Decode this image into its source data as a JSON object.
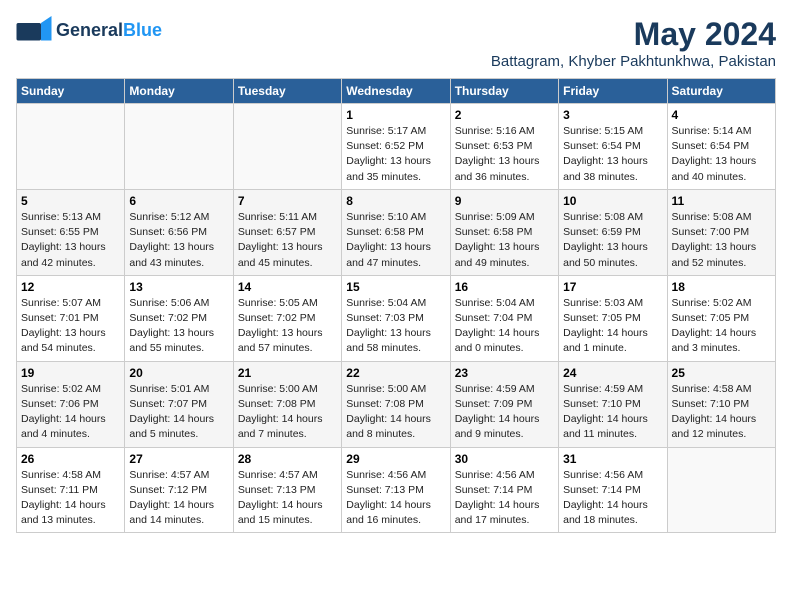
{
  "logo": {
    "general": "General",
    "blue": "Blue"
  },
  "title": {
    "month": "May 2024",
    "location": "Battagram, Khyber Pakhtunkhwa, Pakistan"
  },
  "headers": [
    "Sunday",
    "Monday",
    "Tuesday",
    "Wednesday",
    "Thursday",
    "Friday",
    "Saturday"
  ],
  "weeks": [
    [
      {
        "day": "",
        "info": ""
      },
      {
        "day": "",
        "info": ""
      },
      {
        "day": "",
        "info": ""
      },
      {
        "day": "1",
        "info": "Sunrise: 5:17 AM\nSunset: 6:52 PM\nDaylight: 13 hours\nand 35 minutes."
      },
      {
        "day": "2",
        "info": "Sunrise: 5:16 AM\nSunset: 6:53 PM\nDaylight: 13 hours\nand 36 minutes."
      },
      {
        "day": "3",
        "info": "Sunrise: 5:15 AM\nSunset: 6:54 PM\nDaylight: 13 hours\nand 38 minutes."
      },
      {
        "day": "4",
        "info": "Sunrise: 5:14 AM\nSunset: 6:54 PM\nDaylight: 13 hours\nand 40 minutes."
      }
    ],
    [
      {
        "day": "5",
        "info": "Sunrise: 5:13 AM\nSunset: 6:55 PM\nDaylight: 13 hours\nand 42 minutes."
      },
      {
        "day": "6",
        "info": "Sunrise: 5:12 AM\nSunset: 6:56 PM\nDaylight: 13 hours\nand 43 minutes."
      },
      {
        "day": "7",
        "info": "Sunrise: 5:11 AM\nSunset: 6:57 PM\nDaylight: 13 hours\nand 45 minutes."
      },
      {
        "day": "8",
        "info": "Sunrise: 5:10 AM\nSunset: 6:58 PM\nDaylight: 13 hours\nand 47 minutes."
      },
      {
        "day": "9",
        "info": "Sunrise: 5:09 AM\nSunset: 6:58 PM\nDaylight: 13 hours\nand 49 minutes."
      },
      {
        "day": "10",
        "info": "Sunrise: 5:08 AM\nSunset: 6:59 PM\nDaylight: 13 hours\nand 50 minutes."
      },
      {
        "day": "11",
        "info": "Sunrise: 5:08 AM\nSunset: 7:00 PM\nDaylight: 13 hours\nand 52 minutes."
      }
    ],
    [
      {
        "day": "12",
        "info": "Sunrise: 5:07 AM\nSunset: 7:01 PM\nDaylight: 13 hours\nand 54 minutes."
      },
      {
        "day": "13",
        "info": "Sunrise: 5:06 AM\nSunset: 7:02 PM\nDaylight: 13 hours\nand 55 minutes."
      },
      {
        "day": "14",
        "info": "Sunrise: 5:05 AM\nSunset: 7:02 PM\nDaylight: 13 hours\nand 57 minutes."
      },
      {
        "day": "15",
        "info": "Sunrise: 5:04 AM\nSunset: 7:03 PM\nDaylight: 13 hours\nand 58 minutes."
      },
      {
        "day": "16",
        "info": "Sunrise: 5:04 AM\nSunset: 7:04 PM\nDaylight: 14 hours\nand 0 minutes."
      },
      {
        "day": "17",
        "info": "Sunrise: 5:03 AM\nSunset: 7:05 PM\nDaylight: 14 hours\nand 1 minute."
      },
      {
        "day": "18",
        "info": "Sunrise: 5:02 AM\nSunset: 7:05 PM\nDaylight: 14 hours\nand 3 minutes."
      }
    ],
    [
      {
        "day": "19",
        "info": "Sunrise: 5:02 AM\nSunset: 7:06 PM\nDaylight: 14 hours\nand 4 minutes."
      },
      {
        "day": "20",
        "info": "Sunrise: 5:01 AM\nSunset: 7:07 PM\nDaylight: 14 hours\nand 5 minutes."
      },
      {
        "day": "21",
        "info": "Sunrise: 5:00 AM\nSunset: 7:08 PM\nDaylight: 14 hours\nand 7 minutes."
      },
      {
        "day": "22",
        "info": "Sunrise: 5:00 AM\nSunset: 7:08 PM\nDaylight: 14 hours\nand 8 minutes."
      },
      {
        "day": "23",
        "info": "Sunrise: 4:59 AM\nSunset: 7:09 PM\nDaylight: 14 hours\nand 9 minutes."
      },
      {
        "day": "24",
        "info": "Sunrise: 4:59 AM\nSunset: 7:10 PM\nDaylight: 14 hours\nand 11 minutes."
      },
      {
        "day": "25",
        "info": "Sunrise: 4:58 AM\nSunset: 7:10 PM\nDaylight: 14 hours\nand 12 minutes."
      }
    ],
    [
      {
        "day": "26",
        "info": "Sunrise: 4:58 AM\nSunset: 7:11 PM\nDaylight: 14 hours\nand 13 minutes."
      },
      {
        "day": "27",
        "info": "Sunrise: 4:57 AM\nSunset: 7:12 PM\nDaylight: 14 hours\nand 14 minutes."
      },
      {
        "day": "28",
        "info": "Sunrise: 4:57 AM\nSunset: 7:13 PM\nDaylight: 14 hours\nand 15 minutes."
      },
      {
        "day": "29",
        "info": "Sunrise: 4:56 AM\nSunset: 7:13 PM\nDaylight: 14 hours\nand 16 minutes."
      },
      {
        "day": "30",
        "info": "Sunrise: 4:56 AM\nSunset: 7:14 PM\nDaylight: 14 hours\nand 17 minutes."
      },
      {
        "day": "31",
        "info": "Sunrise: 4:56 AM\nSunset: 7:14 PM\nDaylight: 14 hours\nand 18 minutes."
      },
      {
        "day": "",
        "info": ""
      }
    ]
  ]
}
